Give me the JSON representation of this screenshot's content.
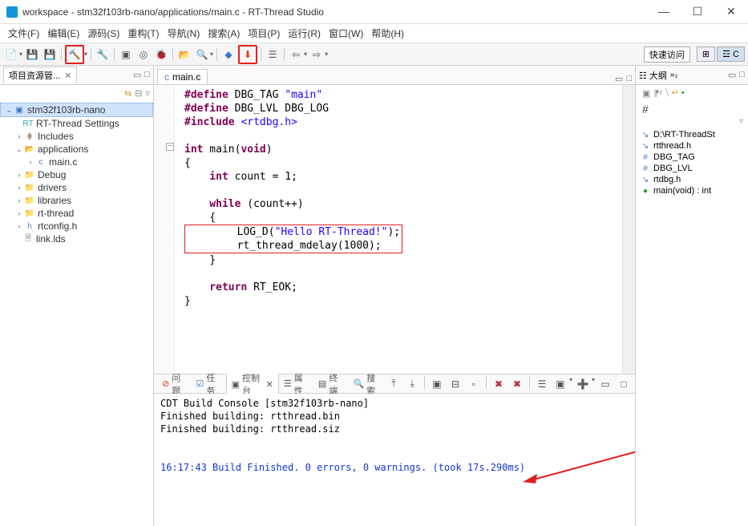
{
  "window": {
    "title": "workspace - stm32f103rb-nano/applications/main.c - RT-Thread Studio"
  },
  "menu": {
    "file": "文件(F)",
    "edit": "编辑(E)",
    "source": "源码(S)",
    "refactor": "重构(T)",
    "navigate": "导航(N)",
    "search": "搜索(A)",
    "project": "项目(P)",
    "run": "运行(R)",
    "window": "窗口(W)",
    "help": "帮助(H)"
  },
  "toolbar": {
    "quick_access": "快速访问",
    "perspective_c": "C"
  },
  "explorer": {
    "title": "项目资源管...",
    "project": "stm32f103rb-nano",
    "items": {
      "rt_settings": "RT-Thread Settings",
      "includes": "Includes",
      "applications": "applications",
      "main_c": "main.c",
      "debug": "Debug",
      "drivers": "drivers",
      "libraries": "libraries",
      "rt_thread": "rt-thread",
      "rtconfig_h": "rtconfig.h",
      "link_lds": "link.lds"
    }
  },
  "editor": {
    "tab": "main.c",
    "code": {
      "l1a": "#define",
      "l1b": " DBG_TAG ",
      "l1c": "\"main\"",
      "l2a": "#define",
      "l2b": " DBG_LVL DBG_LOG",
      "l3a": "#include",
      "l3b": " <rtdbg.h>",
      "l5a": "int",
      "l5b": " main(",
      "l5c": "void",
      "l5d": ")",
      "l6": "{",
      "l7a": "    int",
      "l7b": " count = 1;",
      "l9a": "    while",
      "l9b": " (count++)",
      "l10": "    {",
      "l11a": "        LOG_D(",
      "l11b": "\"Hello RT-Thread!\"",
      "l11c": ");",
      "l12": "        rt_thread_mdelay(1000);",
      "l13": "    }",
      "l15a": "    return",
      "l15b": " RT_EOK;",
      "l16": "}"
    }
  },
  "bottom": {
    "tabs": {
      "problems": "问题",
      "tasks": "任务",
      "console": "控制台",
      "properties": "属性",
      "terminal": "终端",
      "search": "搜索"
    },
    "console": {
      "title": "CDT Build Console [stm32f103rb-nano]",
      "line1": "Finished building: rtthread.bin",
      "line2": "Finished building: rtthread.siz",
      "finish": "16:17:43 Build Finished. 0 errors, 0 warnings. (took 17s.290ms)"
    }
  },
  "outline": {
    "title": "大纲",
    "toolbar_text": "⁋ᶻ",
    "hash_icon": "#",
    "items": {
      "path": "D:\\RT-ThreadSt",
      "rtthread": "rtthread.h",
      "dbg_tag": "DBG_TAG",
      "dbg_lvl": "DBG_LVL",
      "rtdbg": "rtdbg.h",
      "main": "main(void) : int"
    }
  }
}
